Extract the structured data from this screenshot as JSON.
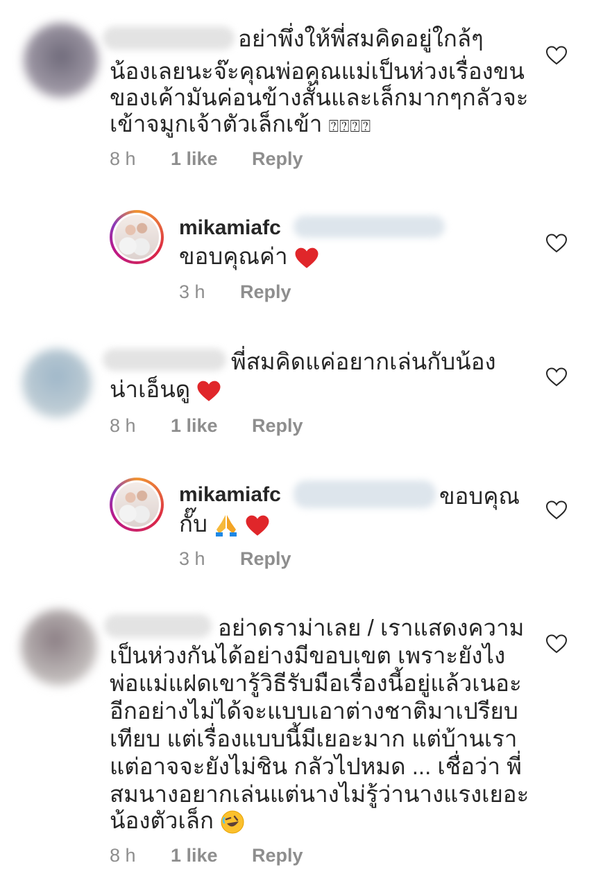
{
  "comments": [
    {
      "lines": [
        "อย่าพึ่งให้พี่สมคิดอยู่ใกล้ๆ",
        "น้องเลยนะจ๊ะคุณพ่อคุณแม่เป็นห่วงเรื่องขน",
        "ของเค้ามันค่อนข้างสั้นและเล็กมากๆกลัวจะ",
        "เข้าจมูกเจ้าตัวเล็กเข้า"
      ],
      "tail_symbols": "⍰⍰⍰⍰",
      "time": "8 h",
      "likes": "1 like",
      "reply": "Reply"
    },
    {
      "username": "mikamiafc",
      "lines": [
        "ขอบคุณค่า"
      ],
      "time": "3 h",
      "reply": "Reply"
    },
    {
      "lines": [
        "พี่สมคิดแค่อยากเล่นกับน้อง",
        "น่าเอ็นดู"
      ],
      "time": "8 h",
      "likes": "1 like",
      "reply": "Reply"
    },
    {
      "username": "mikamiafc",
      "lines": [
        "ขอบคุณ",
        "กั๊บ"
      ],
      "time": "3 h",
      "reply": "Reply"
    },
    {
      "lines": [
        "อย่าดราม่าเลย / เราแสดงความ",
        "เป็นห่วงกันได้อย่างมีขอบเขต เพราะยังไง",
        "พ่อแม่แฝดเขารู้วิธีรับมือเรื่องนี้อยู่แล้วเนอะ",
        "อีกอย่างไม่ได้จะแบบเอาต่างชาติมาเปรียบ",
        "เทียบ แต่เรื่องแบบนี้มีเยอะมาก แต่บ้านเรา",
        "แต่อาจจะยังไม่ชิน กลัวไปหมด ... เชื่อว่า พี่",
        "สมนางอยากเล่นแต่นางไม่รู้ว่านางแรงเยอะ",
        "น้องตัวเล็ก"
      ],
      "time": "8 h",
      "likes": "1 like",
      "reply": "Reply"
    }
  ],
  "icons": {
    "heart": "heart-outline-icon",
    "red_heart": "red-heart-emoji",
    "pray": "folded-hands-emoji",
    "laugh": "rolling-laughing-emoji"
  },
  "colors": {
    "text": "#262626",
    "meta": "#8e8e8e",
    "heart_emoji": "#e0262a"
  }
}
